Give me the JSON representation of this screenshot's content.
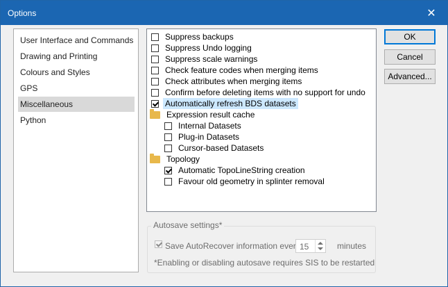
{
  "window": {
    "title": "Options"
  },
  "sidebar": {
    "items": [
      {
        "label": "User Interface and Commands"
      },
      {
        "label": "Drawing and Printing"
      },
      {
        "label": "Colours and Styles"
      },
      {
        "label": "GPS"
      },
      {
        "label": "Miscellaneous",
        "selected": true
      },
      {
        "label": "Python"
      }
    ]
  },
  "tree": {
    "items": [
      {
        "label": "Suppress backups",
        "checked": false
      },
      {
        "label": "Suppress Undo logging",
        "checked": false
      },
      {
        "label": "Suppress scale warnings",
        "checked": false
      },
      {
        "label": "Check feature codes when merging items",
        "checked": false
      },
      {
        "label": "Check attributes when merging items",
        "checked": false
      },
      {
        "label": "Confirm before deleting items with no support for undo",
        "checked": false
      },
      {
        "label": "Automatically refresh BDS datasets",
        "checked": true,
        "selected": true
      },
      {
        "label": "Expression result cache",
        "folder": true
      },
      {
        "label": "Internal Datasets",
        "checked": false
      },
      {
        "label": "Plug-in Datasets",
        "checked": false
      },
      {
        "label": "Cursor-based Datasets",
        "checked": false
      },
      {
        "label": "Topology",
        "folder": true
      },
      {
        "label": "Automatic TopoLineString creation",
        "checked": true
      },
      {
        "label": "Favour old geometry in splinter removal",
        "checked": false
      }
    ]
  },
  "buttons": {
    "ok": "OK",
    "cancel": "Cancel",
    "advanced": "Advanced..."
  },
  "autosave": {
    "title": "Autosave settings*",
    "checkbox_label": "Save AutoRecover information every",
    "checked": true,
    "interval": "15",
    "unit": "minutes",
    "note": "*Enabling or disabling autosave requires SIS to be restarted"
  }
}
